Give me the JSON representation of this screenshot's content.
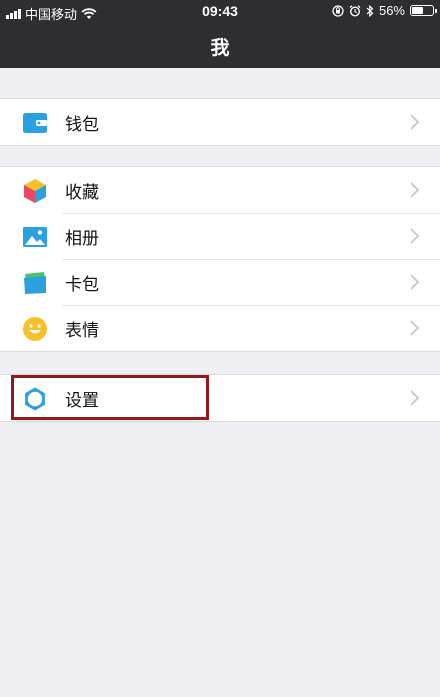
{
  "status_bar": {
    "carrier": "中国移动",
    "time": "09:43",
    "battery_percent": "56%",
    "battery_level": 0.56
  },
  "nav": {
    "title": "我"
  },
  "groups": [
    {
      "items": [
        {
          "label": "钱包",
          "icon": "wallet-icon"
        }
      ]
    },
    {
      "items": [
        {
          "label": "收藏",
          "icon": "favorites-cube-icon"
        },
        {
          "label": "相册",
          "icon": "album-picture-icon"
        },
        {
          "label": "卡包",
          "icon": "card-pack-icon"
        },
        {
          "label": "表情",
          "icon": "emoji-smile-icon"
        }
      ]
    },
    {
      "items": [
        {
          "label": "设置",
          "icon": "settings-gear-icon"
        }
      ]
    }
  ],
  "colors": {
    "bar": "#2e2e32",
    "background": "#efeff4",
    "highlight_border": "#8e1a1a",
    "icon_blue": "#2aa0e0"
  }
}
